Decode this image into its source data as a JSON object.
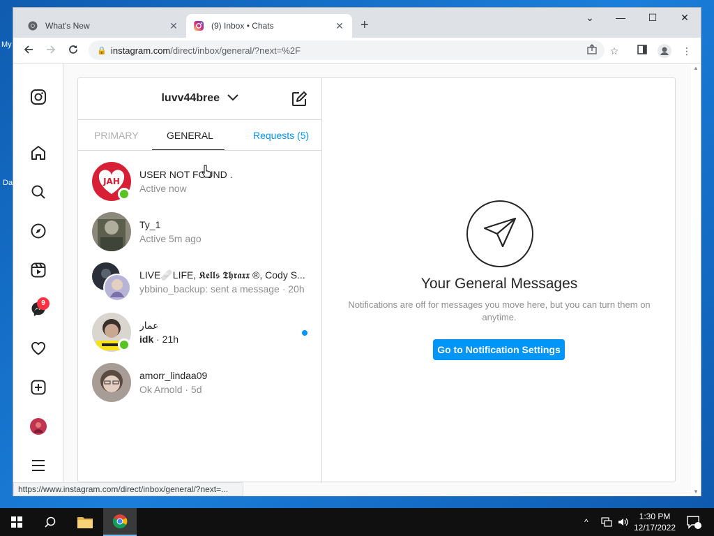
{
  "desktop": {
    "labels": [
      "My",
      "Da"
    ]
  },
  "browser": {
    "tabs": [
      {
        "title": "What's New",
        "active": false
      },
      {
        "title": "(9) Inbox • Chats",
        "active": true
      }
    ],
    "url_host": "instagram.com",
    "url_path": "/direct/inbox/general/?next=%2F",
    "status_url": "https://www.instagram.com/direct/inbox/general/?next=..."
  },
  "sidebar": {
    "messages_badge": "9"
  },
  "dm": {
    "username": "luvv44bree",
    "tabs": {
      "primary": "PRIMARY",
      "general": "GENERAL",
      "requests": "Requests (5)"
    },
    "threads": [
      {
        "name": "USER NOT FOUND .",
        "sub": "Active now",
        "online": true,
        "unread": false
      },
      {
        "name": "Ty_1",
        "sub": "Active 5m ago",
        "online": false,
        "unread": false
      },
      {
        "name": "LIVE🩹LIFE, 𝕶𝖊𝖑𝖑𝖘 𝕿𝖍𝖗𝖆𝖝𝖝 ®, Cody S...",
        "sub": "ybbino_backup: sent a message · 20h",
        "online": false,
        "unread": false
      },
      {
        "name": "عمار",
        "sub_bold": "idk",
        "sub": " · 21h",
        "online": true,
        "unread": true
      },
      {
        "name": "amorr_lindaa09",
        "sub": "Ok Arnold · 5d",
        "online": false,
        "unread": false
      }
    ],
    "empty": {
      "title": "Your General Messages",
      "desc": "Notifications are off for messages you move here, but you can turn them on anytime.",
      "button": "Go to Notification Settings"
    }
  },
  "taskbar": {
    "time": "1:30 PM",
    "date": "12/17/2022",
    "notif_count": "2"
  }
}
